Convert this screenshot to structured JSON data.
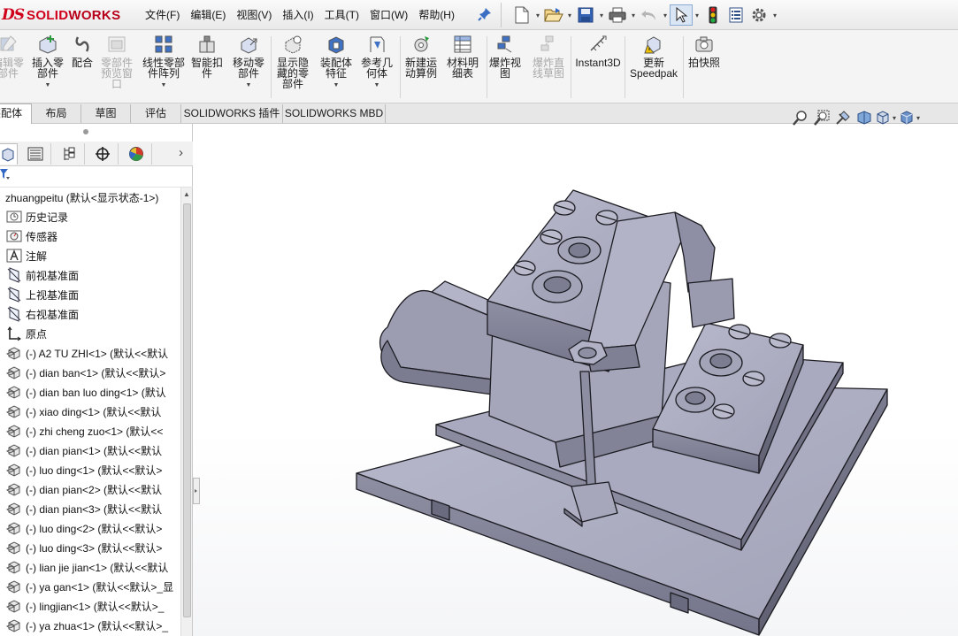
{
  "app": {
    "logo_ds": "DS",
    "logo_text_a": "SOLID",
    "logo_text_b": "WORKS",
    "logo_arrow": "›"
  },
  "menu": {
    "items": [
      "文件(F)",
      "编辑(E)",
      "视图(V)",
      "插入(I)",
      "工具(T)",
      "窗口(W)",
      "帮助(H)"
    ],
    "pin_icon": "pin-icon"
  },
  "quick_access": {
    "icons": [
      "new-document-icon",
      "open-icon",
      "save-icon",
      "print-icon",
      "undo-icon",
      "select-cursor-icon",
      "rebuild-traffic-light-icon",
      "file-properties-icon",
      "options-gear-icon"
    ]
  },
  "command_manager": {
    "buttons": [
      {
        "id": "edit-component",
        "label": "编辑零\n部件",
        "disabled": true,
        "dropdown": false
      },
      {
        "id": "insert-component",
        "label": "插入零\n部件",
        "disabled": false,
        "dropdown": true
      },
      {
        "id": "mate",
        "label": "配合",
        "disabled": false,
        "dropdown": false
      },
      {
        "id": "component-preview",
        "label": "零部件\n预览窗\n口",
        "disabled": true,
        "dropdown": false
      },
      {
        "id": "linear-pattern",
        "label": "线性零部\n件阵列",
        "disabled": false,
        "dropdown": true
      },
      {
        "id": "smart-fasteners",
        "label": "智能扣\n件",
        "disabled": false,
        "dropdown": false
      },
      {
        "id": "move-component",
        "label": "移动零\n部件",
        "disabled": false,
        "dropdown": true
      },
      {
        "id": "show-hidden",
        "label": "显示隐\n藏的零\n部件",
        "disabled": false,
        "dropdown": false
      },
      {
        "id": "assembly-feature",
        "label": "装配体\n特征",
        "disabled": false,
        "dropdown": true
      },
      {
        "id": "reference-geometry",
        "label": "参考几\n何体",
        "disabled": false,
        "dropdown": true
      },
      {
        "id": "new-motion-study",
        "label": "新建运\n动算例",
        "disabled": false,
        "dropdown": false
      },
      {
        "id": "bill-of-materials",
        "label": "材料明\n细表",
        "disabled": false,
        "dropdown": false
      },
      {
        "id": "exploded-view",
        "label": "爆炸视\n图",
        "disabled": false,
        "dropdown": false
      },
      {
        "id": "explode-line-sketch",
        "label": "爆炸直\n线草图",
        "disabled": true,
        "dropdown": false
      },
      {
        "id": "instant3d",
        "label": "Instant3D",
        "disabled": false,
        "dropdown": false
      },
      {
        "id": "update-speedpak",
        "label": "更新\nSpeedpak",
        "disabled": false,
        "dropdown": false
      },
      {
        "id": "snapshot",
        "label": "拍快照",
        "disabled": false,
        "dropdown": false
      }
    ]
  },
  "tabs": [
    "装配体",
    "布局",
    "草图",
    "评估",
    "SOLIDWORKS 插件",
    "SOLIDWORKS MBD"
  ],
  "panel": {
    "tab_icons": [
      "feature-manager-icon",
      "property-manager-icon",
      "configuration-manager-icon",
      "dimxpert-icon",
      "display-manager-icon"
    ],
    "more_label": "›",
    "filter_icon": "filter-icon"
  },
  "tree": {
    "root": "zhuangpeitu  (默认<显示状态-1>)",
    "items": [
      {
        "icon": "history-icon",
        "label": "历史记录"
      },
      {
        "icon": "sensor-icon",
        "label": "传感器"
      },
      {
        "icon": "annotation-icon",
        "label": "注解"
      },
      {
        "icon": "plane-icon",
        "label": "前视基准面"
      },
      {
        "icon": "plane-icon",
        "label": "上视基准面"
      },
      {
        "icon": "plane-icon",
        "label": "右视基准面"
      },
      {
        "icon": "origin-icon",
        "label": "原点"
      },
      {
        "icon": "part-icon",
        "label": "(-) A2 TU ZHI<1> (默认<<默认"
      },
      {
        "icon": "part-icon",
        "label": "(-) dian ban<1> (默认<<默认>"
      },
      {
        "icon": "part-icon",
        "label": "(-) dian ban luo ding<1> (默认"
      },
      {
        "icon": "part-icon",
        "label": "(-) xiao  ding<1> (默认<<默认"
      },
      {
        "icon": "part-icon",
        "label": "(-) zhi cheng zuo<1> (默认<<"
      },
      {
        "icon": "part-icon",
        "label": "(-) dian   pian<1> (默认<<默认"
      },
      {
        "icon": "part-icon",
        "label": "(-) luo ding<1> (默认<<默认>"
      },
      {
        "icon": "part-icon",
        "label": "(-) dian   pian<2> (默认<<默认"
      },
      {
        "icon": "part-icon",
        "label": "(-) dian   pian<3> (默认<<默认"
      },
      {
        "icon": "part-icon",
        "label": "(-) luo ding<2> (默认<<默认>"
      },
      {
        "icon": "part-icon",
        "label": "(-) luo ding<3> (默认<<默认>"
      },
      {
        "icon": "part-icon",
        "label": "(-) lian jie jian<1> (默认<<默认"
      },
      {
        "icon": "part-icon",
        "label": "(-) ya gan<1> (默认<<默认>_显"
      },
      {
        "icon": "part-icon",
        "label": "(-) lingjian<1> (默认<<默认>_"
      },
      {
        "icon": "part-icon",
        "label": "(-) ya zhua<1> (默认<<默认>_"
      }
    ]
  },
  "headsup": {
    "icons": [
      "zoom-to-fit-icon",
      "zoom-to-area-icon",
      "previous-view-icon",
      "section-view-icon",
      "view-orientation-icon",
      "display-style-icon"
    ]
  },
  "colors": {
    "brand": "#d0001b",
    "model_face": "#9fa0b4",
    "model_edge": "#1c1c22"
  }
}
